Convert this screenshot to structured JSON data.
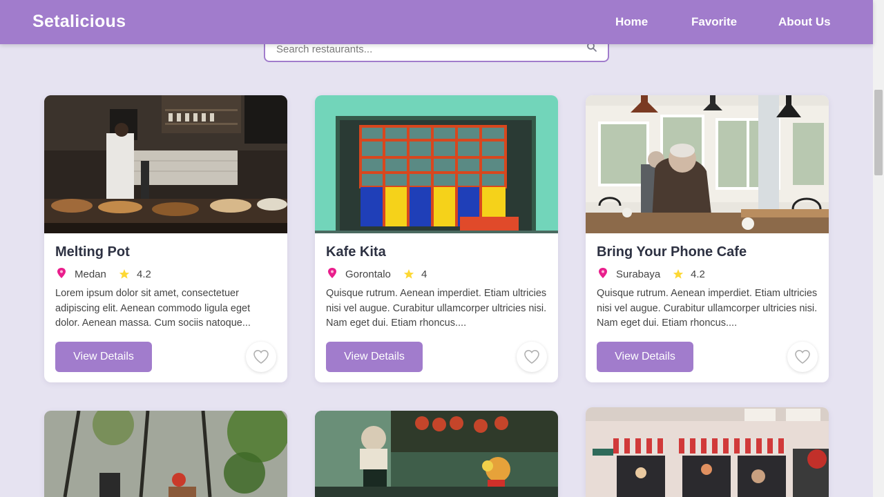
{
  "brand": "Setalicious",
  "nav": {
    "home": "Home",
    "favorite": "Favorite",
    "about": "About Us"
  },
  "search": {
    "placeholder": "Search restaurants...",
    "icon": "search-icon"
  },
  "colors": {
    "primary": "#a17ccc",
    "background": "#e6e3f1",
    "pin": "#e91e8c",
    "star": "#fdd835"
  },
  "restaurants": [
    {
      "name": "Melting Pot",
      "city": "Medan",
      "rating": "4.2",
      "description": "Lorem ipsum dolor sit amet, consectetuer adipiscing elit. Aenean commodo ligula eget dolor. Aenean massa. Cum sociis natoque...",
      "button": "View Details"
    },
    {
      "name": "Kafe Kita",
      "city": "Gorontalo",
      "rating": "4",
      "description": "Quisque rutrum. Aenean imperdiet. Etiam ultricies nisi vel augue. Curabitur ullamcorper ultricies nisi. Nam eget dui. Etiam rhoncus....",
      "button": "View Details"
    },
    {
      "name": "Bring Your Phone Cafe",
      "city": "Surabaya",
      "rating": "4.2",
      "description": "Quisque rutrum. Aenean imperdiet. Etiam ultricies nisi vel augue. Curabitur ullamcorper ultricies nisi. Nam eget dui. Etiam rhoncus....",
      "button": "View Details"
    }
  ]
}
